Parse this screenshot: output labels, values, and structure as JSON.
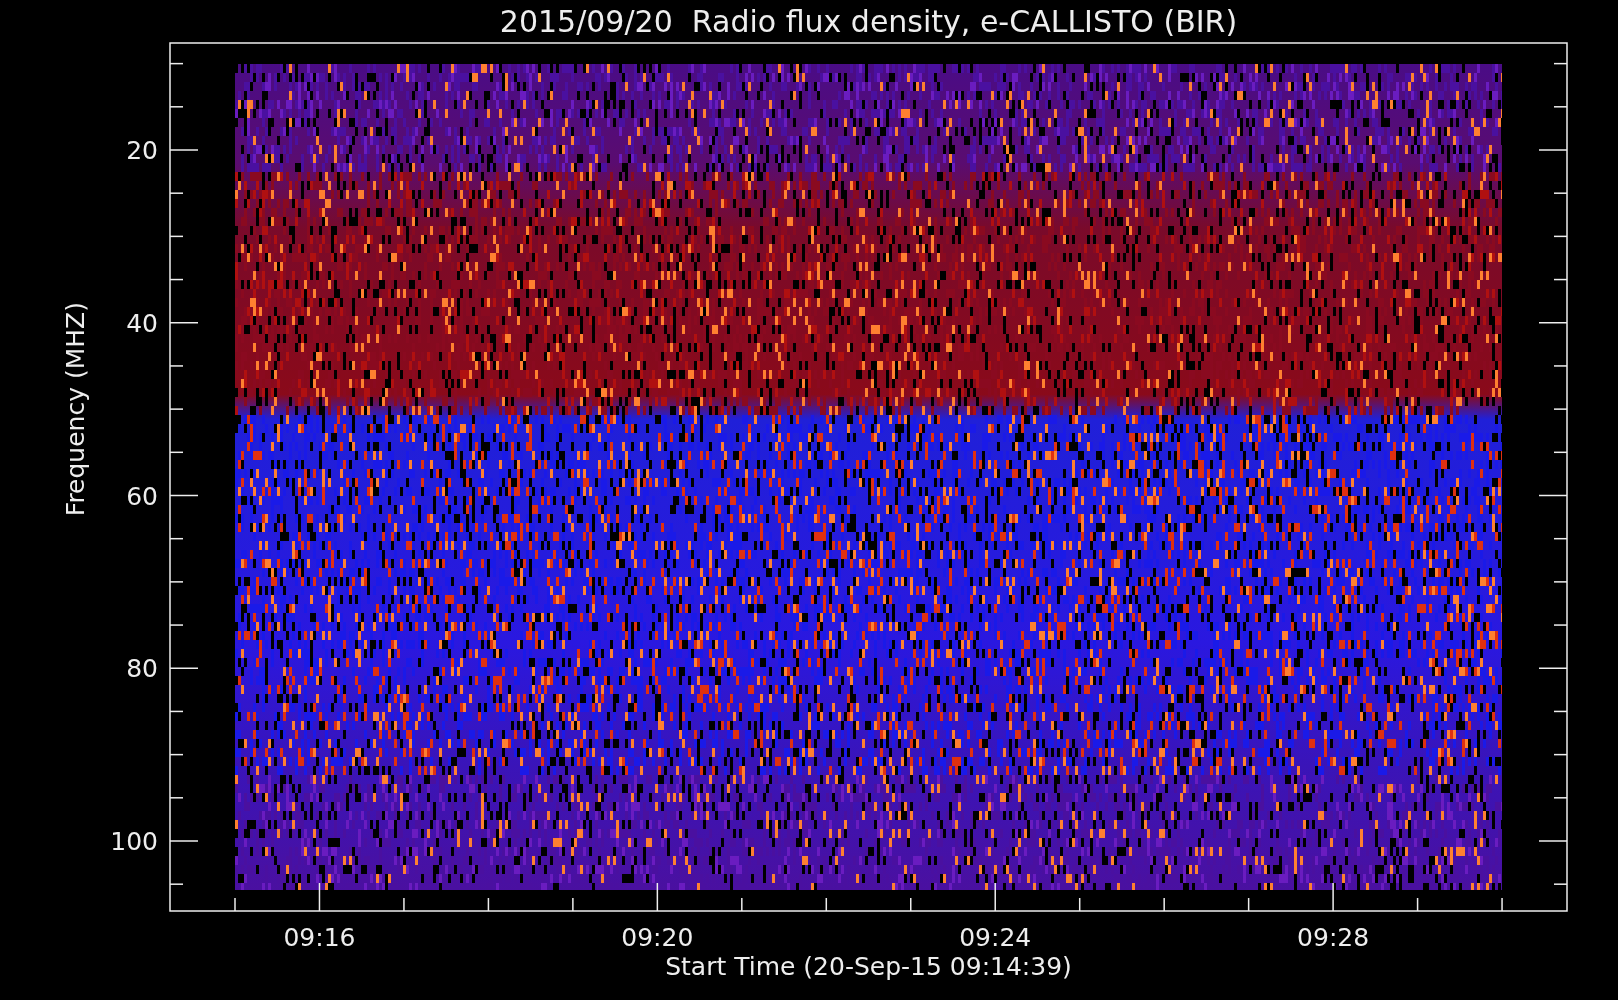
{
  "plot": {
    "title": "2015/09/20  Radio flux density, e-CALLISTO (BIR)",
    "ylabel": "Frequency (MHZ)",
    "xlabel": "Start Time (20-Sep-15 09:14:39)",
    "yticks": [
      "20",
      "40",
      "60",
      "80",
      "100"
    ],
    "xticks": [
      "09:16",
      "09:20",
      "09:24",
      "09:28"
    ]
  }
}
